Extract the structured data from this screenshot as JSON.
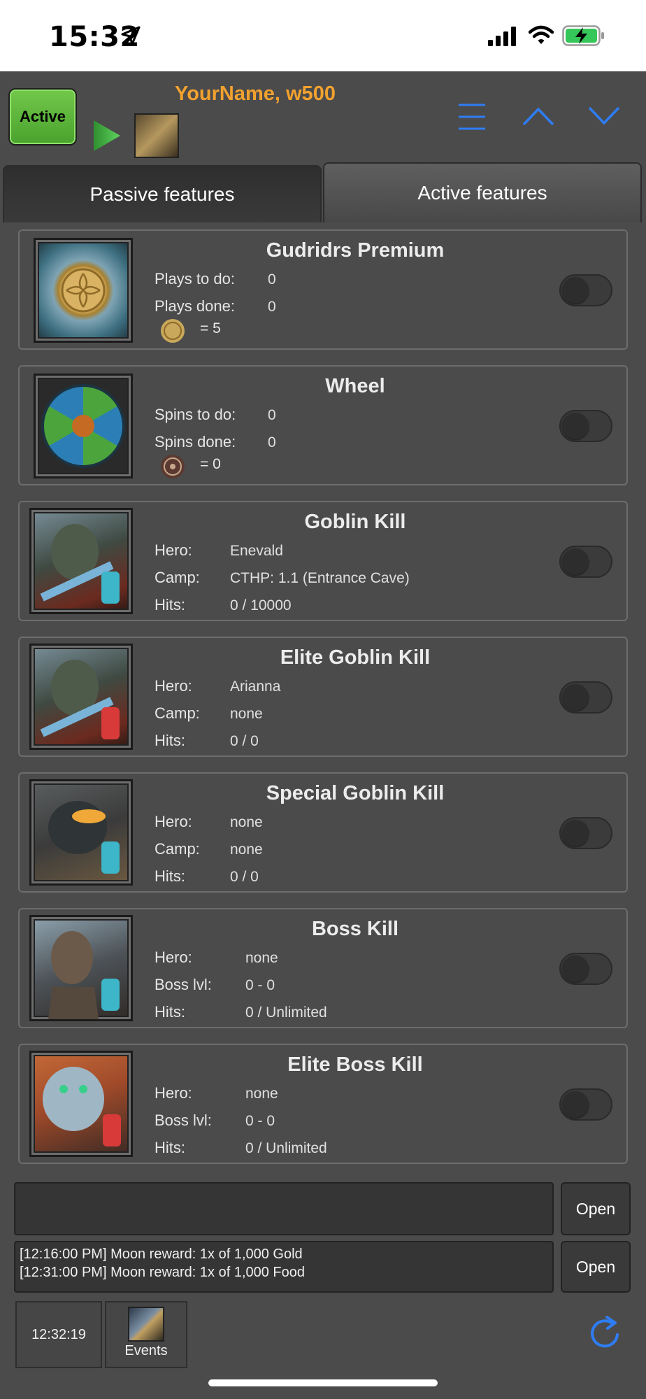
{
  "status_bar": {
    "time": "15:32",
    "icons": [
      "location-arrow-icon",
      "cellular-signal-icon",
      "wifi-icon",
      "battery-charging-icon"
    ]
  },
  "header": {
    "active_label": "Active",
    "account_name": "YourName, w500",
    "icons": [
      "play-icon",
      "scroll-icon",
      "menu-icon",
      "chevron-up-icon",
      "chevron-down-icon"
    ],
    "accent_color": "#f2a12f",
    "nav_icon_color": "#2f7df5"
  },
  "tabs": [
    {
      "label": "Passive features"
    },
    {
      "label": "Active features"
    }
  ],
  "features": [
    {
      "title": "Gudridrs Premium",
      "rows": [
        {
          "label": "Plays to do:",
          "value": "0"
        },
        {
          "label": "Plays done:",
          "value": "0"
        }
      ],
      "coin_text": "= 5",
      "enabled": false
    },
    {
      "title": "Wheel",
      "rows": [
        {
          "label": "Spins to do:",
          "value": "0"
        },
        {
          "label": "Spins done:",
          "value": "0"
        }
      ],
      "coin_text": "= 0",
      "enabled": false
    },
    {
      "title": "Goblin Kill",
      "rows": [
        {
          "label": "Hero:",
          "value": "Enevald"
        },
        {
          "label": "Camp:",
          "value": "CTHP: 1.1 (Entrance Cave)"
        },
        {
          "label": "Hits:",
          "value": "0 / 10000"
        }
      ],
      "enabled": false
    },
    {
      "title": "Elite Goblin Kill",
      "rows": [
        {
          "label": "Hero:",
          "value": "Arianna"
        },
        {
          "label": "Camp:",
          "value": "none"
        },
        {
          "label": "Hits:",
          "value": "0 / 0"
        }
      ],
      "enabled": false
    },
    {
      "title": "Special Goblin Kill",
      "rows": [
        {
          "label": "Hero:",
          "value": "none"
        },
        {
          "label": "Camp:",
          "value": "none"
        },
        {
          "label": "Hits:",
          "value": "0 / 0"
        }
      ],
      "enabled": false
    },
    {
      "title": "Boss Kill",
      "rows": [
        {
          "label": "Hero:",
          "value": "none"
        },
        {
          "label": "Boss lvl:",
          "value": "0 - 0"
        },
        {
          "label": "Hits:",
          "value": "0 / Unlimited"
        }
      ],
      "enabled": false
    },
    {
      "title": "Elite Boss Kill",
      "rows": [
        {
          "label": "Hero:",
          "value": "none"
        },
        {
          "label": "Boss lvl:",
          "value": "0 - 0"
        },
        {
          "label": "Hits:",
          "value": "0 / Unlimited"
        }
      ],
      "enabled": false
    }
  ],
  "log": {
    "open_label": "Open",
    "entries": [
      "[12:16:00 PM]  Moon reward: 1x of 1,000 Gold",
      "[12:31:00 PM]  Moon reward: 1x of 1,000 Food"
    ]
  },
  "footer": {
    "clock": "12:32:19",
    "events_label": "Events",
    "icons": [
      "events-icon",
      "refresh-icon"
    ]
  }
}
